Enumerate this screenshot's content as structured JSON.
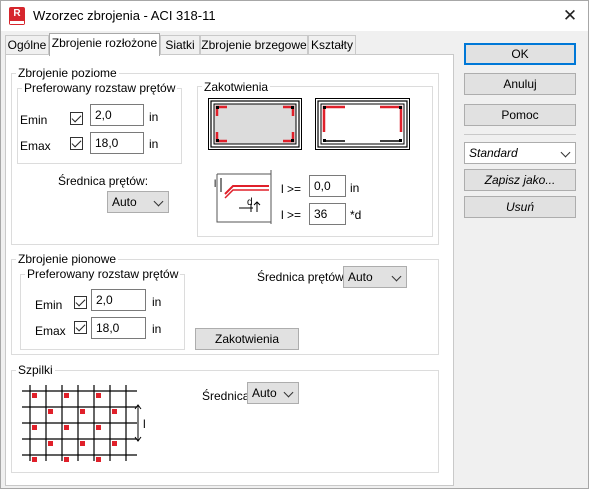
{
  "window": {
    "title": "Wzorzec zbrojenia - ACI 318-11",
    "app_icon": "revit-r-icon",
    "close_icon": "close-icon"
  },
  "tabs": [
    {
      "label": "Ogólne"
    },
    {
      "label": "Zbrojenie rozłożone"
    },
    {
      "label": "Siatki"
    },
    {
      "label": "Zbrojenie brzegowe"
    },
    {
      "label": "Kształty"
    }
  ],
  "horizontal": {
    "title": "Zbrojenie poziome",
    "spacing_group": "Preferowany rozstaw prętów",
    "emin_label": "Emin",
    "emin_value": "2,0",
    "emin_unit": "in",
    "emin_checked": true,
    "emax_label": "Emax",
    "emax_value": "18,0",
    "emax_unit": "in",
    "emax_checked": true,
    "diameter_label": "Średnica prętów:",
    "diameter_value": "Auto"
  },
  "anchorage": {
    "title": "Zakotwienia",
    "l_label_1": "l >=",
    "l_value_1": "0,0",
    "l_unit_1": "in",
    "l_label_2": "l >=",
    "l_value_2": "36",
    "l_unit_2": "*d",
    "diagram_l": "l",
    "diagram_d": "d"
  },
  "vertical": {
    "title": "Zbrojenie pionowe",
    "spacing_group": "Preferowany rozstaw prętów",
    "emin_label": "Emin",
    "emin_value": "2,0",
    "emin_unit": "in",
    "emin_checked": true,
    "emax_label": "Emax",
    "emax_value": "18,0",
    "emax_unit": "in",
    "emax_checked": true,
    "diameter_label": "Średnica prętów:",
    "diameter_value": "Auto",
    "anchor_button": "Zakotwienia"
  },
  "ties": {
    "title": "Szpilki",
    "diameter_label": "Średnica",
    "diameter_value": "Auto",
    "diagram_l": "l"
  },
  "side_buttons": {
    "ok": "OK",
    "cancel": "Anuluj",
    "help": "Pomoc",
    "standard": "Standard",
    "save_as": "Zapisz jako...",
    "delete": "Usuń"
  },
  "colors": {
    "accent": "#0078d7",
    "rebar": "#e0202a"
  }
}
